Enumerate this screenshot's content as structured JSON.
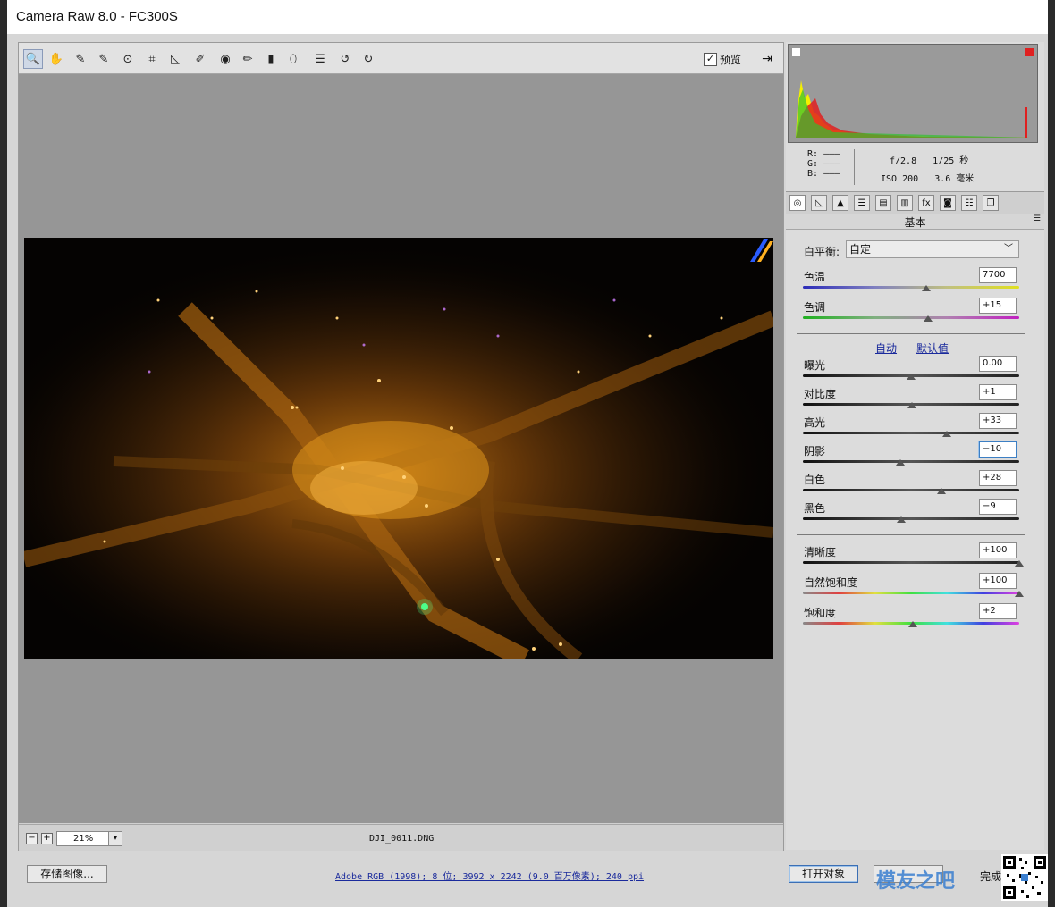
{
  "window": {
    "title": "Camera Raw 8.0 -  FC300S"
  },
  "toolbar": {
    "tools": [
      {
        "icon": "zoom-icon",
        "glyph": "🔍"
      },
      {
        "icon": "hand-icon",
        "glyph": "✋"
      },
      {
        "icon": "white-balance-icon",
        "glyph": "✎"
      },
      {
        "icon": "color-sampler-icon",
        "glyph": "✎"
      },
      {
        "icon": "target-adjust-icon",
        "glyph": "⊙"
      },
      {
        "icon": "crop-icon",
        "glyph": "⌗"
      },
      {
        "icon": "straighten-icon",
        "glyph": "◺"
      },
      {
        "icon": "spot-removal-icon",
        "glyph": "✐"
      },
      {
        "icon": "red-eye-icon",
        "glyph": "◉"
      },
      {
        "icon": "adjustment-brush-icon",
        "glyph": "✏"
      },
      {
        "icon": "graduated-filter-icon",
        "glyph": "▮"
      },
      {
        "icon": "radial-filter-icon",
        "glyph": "⬯"
      },
      {
        "icon": "preferences-icon",
        "glyph": "☰"
      },
      {
        "icon": "rotate-ccw-icon",
        "glyph": "↺"
      },
      {
        "icon": "rotate-cw-icon",
        "glyph": "↻"
      }
    ],
    "preview_label": "预览",
    "preview_checked": true
  },
  "status": {
    "zoom": "21%",
    "filename": "DJI_0011.DNG"
  },
  "info": {
    "r_label": "R:",
    "g_label": "G:",
    "b_label": "B:",
    "rgb_dash": "———",
    "aperture": "f/2.8",
    "shutter": "1/25 秒",
    "iso": "ISO 200",
    "focal": "3.6 毫米"
  },
  "panel": {
    "title": "基本",
    "tabs": [
      "basic-icon",
      "tone-curve-icon",
      "detail-icon",
      "hsl-icon",
      "split-toning-icon",
      "lens-icon",
      "fx-icon",
      "camera-calibration-icon",
      "presets-icon",
      "snapshots-icon"
    ],
    "white_balance": {
      "label": "白平衡:",
      "value": "自定"
    },
    "auto_label": "自动",
    "default_label": "默认值",
    "sliders": [
      {
        "key": "temp",
        "label": "色温",
        "value": "7700",
        "pos": 0.57,
        "track": "temp"
      },
      {
        "key": "tint",
        "label": "色调",
        "value": "+15",
        "pos": 0.58,
        "track": "tint"
      },
      {
        "key": "exposure",
        "label": "曝光",
        "value": "0.00",
        "pos": 0.5,
        "track": "gray"
      },
      {
        "key": "contrast",
        "label": "对比度",
        "value": "+1",
        "pos": 0.505,
        "track": "gray"
      },
      {
        "key": "highlights",
        "label": "高光",
        "value": "+33",
        "pos": 0.665,
        "track": "gray"
      },
      {
        "key": "shadows",
        "label": "阴影",
        "value": "−10",
        "pos": 0.45,
        "track": "gray",
        "focused": true
      },
      {
        "key": "whites",
        "label": "白色",
        "value": "+28",
        "pos": 0.64,
        "track": "gray"
      },
      {
        "key": "blacks",
        "label": "黑色",
        "value": "−9",
        "pos": 0.455,
        "track": "gray"
      },
      {
        "key": "clarity",
        "label": "清晰度",
        "value": "+100",
        "pos": 1.0,
        "track": "gray"
      },
      {
        "key": "vibrance",
        "label": "自然饱和度",
        "value": "+100",
        "pos": 1.0,
        "track": "rainbow"
      },
      {
        "key": "saturation",
        "label": "饱和度",
        "value": "+2",
        "pos": 0.51,
        "track": "rainbow"
      }
    ]
  },
  "bottom": {
    "save_label": "存储图像...",
    "workflow_label": "Adobe RGB (1998); 8 位; 3992 x 2242 (9.0 百万像素); 240 ppi",
    "open_label": "打开对象",
    "done_label": "完成",
    "watermark": "模友之吧"
  },
  "colors": {
    "photo_orange": "#d98a1a",
    "link_blue": "#1a2a9c",
    "histo_yellow": "#f5f000",
    "histo_red": "#e02020"
  }
}
